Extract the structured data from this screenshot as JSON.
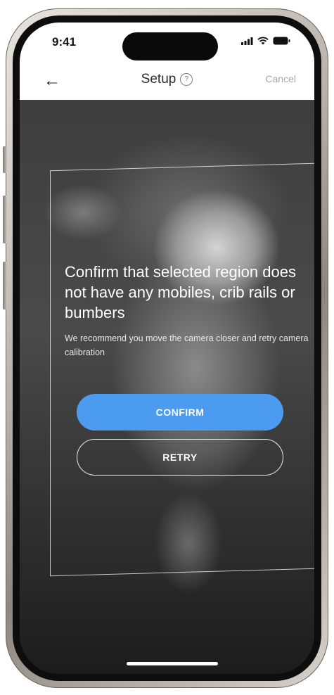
{
  "status_bar": {
    "time": "9:41",
    "icons": [
      "signal-icon",
      "wifi-icon",
      "battery-icon"
    ]
  },
  "nav": {
    "back_icon": "back-arrow-icon",
    "title": "Setup",
    "help_icon": "help-icon",
    "help_glyph": "?",
    "cancel_label": "Cancel"
  },
  "calibration": {
    "headline": "Confirm that selected region does not have any mobiles, crib rails or bumbers",
    "subtext": "We recommend you move the camera closer and retry camera calibration",
    "confirm_label": "CONFIRM",
    "retry_label": "RETRY"
  },
  "colors": {
    "accent": "#4b9cf0",
    "header_bg": "#ffffff",
    "cancel_text": "#a7a7a7"
  }
}
